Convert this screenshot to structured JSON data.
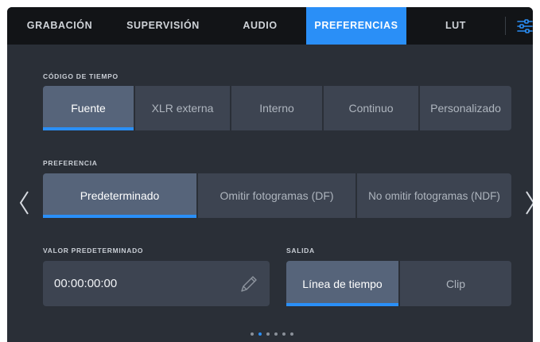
{
  "tabs": [
    {
      "label": "GRABACIÓN",
      "active": false
    },
    {
      "label": "SUPERVISIÓN",
      "active": false
    },
    {
      "label": "AUDIO",
      "active": false
    },
    {
      "label": "PREFERENCIAS",
      "active": true
    },
    {
      "label": "LUT",
      "active": false
    }
  ],
  "timecode": {
    "section_label": "CÓDIGO DE TIEMPO",
    "options": [
      "Fuente",
      "XLR externa",
      "Interno",
      "Continuo",
      "Personalizado"
    ],
    "selected": "Fuente"
  },
  "preference": {
    "section_label": "PREFERENCIA",
    "options": [
      "Predeterminado",
      "Omitir fotogramas (DF)",
      "No omitir fotogramas (NDF)"
    ],
    "selected": "Predeterminado"
  },
  "default_value": {
    "section_label": "VALOR PREDETERMINADO",
    "value": "00:00:00:00"
  },
  "output": {
    "section_label": "SALIDA",
    "options": [
      "Línea de tiempo",
      "Clip"
    ],
    "selected": "Línea de tiempo"
  },
  "pagination": {
    "pages": 6,
    "current": 2
  },
  "colors": {
    "accent": "#2a8ff7",
    "panel": "#2a2f37",
    "button": "#3d4451",
    "button_active": "#56647a"
  }
}
